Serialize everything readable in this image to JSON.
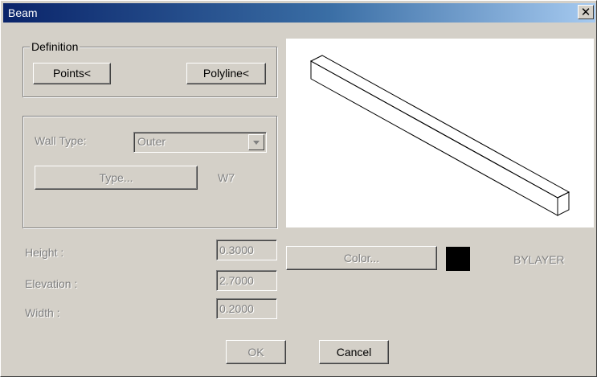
{
  "window": {
    "title": "Beam",
    "close_glyph": "✕"
  },
  "definition": {
    "legend": "Definition",
    "points_button": "Points<",
    "polyline_button": "Polyline<"
  },
  "wall": {
    "type_label": "Wall Type:",
    "type_value": "Outer",
    "type_button": "Type...",
    "type_code": "W7"
  },
  "dimensions": {
    "height_label": "Height   :",
    "height_value": "0.3000",
    "elevation_label": "Elevation :",
    "elevation_value": "2.7000",
    "width_label": "Width    :",
    "width_value": "0.2000"
  },
  "color": {
    "button": "Color...",
    "swatch_color": "#000000",
    "value": "BYLAYER"
  },
  "buttons": {
    "ok": "OK",
    "cancel": "Cancel"
  },
  "preview": {
    "icon": "beam-3d-preview"
  }
}
